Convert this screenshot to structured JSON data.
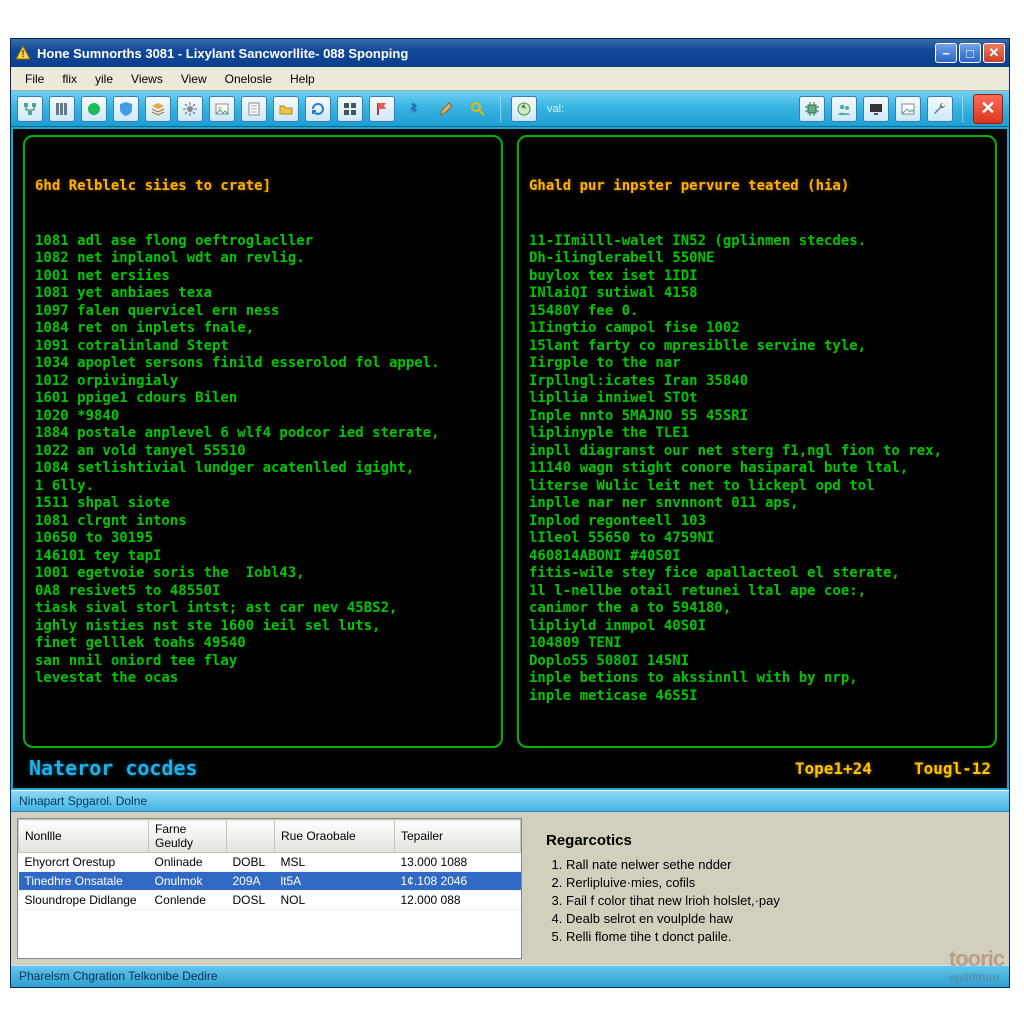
{
  "window": {
    "title": "Hone Sumnorths 3081 - Lixylant Sancworllite- 088 Sponping"
  },
  "menu": [
    "File",
    "flix",
    "yile",
    "Views",
    "View",
    "Onelosle",
    "Help"
  ],
  "toolbar": {
    "icons": [
      "tree-icon",
      "columns-icon",
      "globe-icon",
      "shield-icon",
      "layers-icon",
      "gear-icon",
      "picture-icon",
      "sheet-icon",
      "folder-icon",
      "refresh-icon",
      "grid-icon",
      "flag-icon",
      "tack-icon",
      "pencil-icon",
      "search-icon"
    ],
    "icons2": [
      "compass-icon"
    ],
    "search_field": "val:",
    "icons_right": [
      "chip-icon",
      "people-icon",
      "screen-icon",
      "image-icon",
      "wrench-icon"
    ],
    "close_label": "✕"
  },
  "console": {
    "left_title": "6hd Relblelc siies to crate]",
    "left_lines": [
      "1081 adl ase flong oeftroglacller",
      "1082 net inplanol wdt an revlig.",
      "1001 net ersiies",
      "1081 yet anbiaes texa",
      "1097 falen quervicel ern ness",
      "1084 ret on inplets fnale,",
      "1091 cotralinland Stept",
      "1034 apoplet sersons finild esserolod fol appel.",
      "1012 orpivingialy",
      "1601 ppige1 cdours Bilen",
      "1020 *9840",
      "1884 postale anplevel 6 wlf4 podcor ied sterate,",
      "1022 an vold tanyel 55510",
      "1084 setlishtivial lundger acatenlled igight,",
      "1 6lly.",
      "1511 shpal siote",
      "1081 clrgnt intons",
      "10650 to 30195",
      "146101 tey tapI",
      "1001 egetvoie soris the  Iobl43,",
      "0A8 resivet5 to 48550I",
      "tiask sival storl intst; ast car nev 45BS2,",
      "ighly nisties nst ste 1600 ieil sel luts,",
      "finet gelllek toahs 49540",
      "san nnil oniord tee flay",
      "levestat the ocas"
    ],
    "right_title": "Ghald pur inpster pervure teated (hia)",
    "right_lines": [
      "11-IImilll-walet IN52 (gplinmen stecdes.",
      "Dh-ilinglerabell 550NE",
      "buylox tex iset 1IDI",
      "INlaiQI sutiwal 4158",
      "15480Y fee 0.",
      "1Iingtio campol fise 1002",
      "15lant farty co mpresiblle servine tyle,",
      "Iirgple to the nar",
      "Irpllngl:icates Iran 35840",
      "lipllia inniwel STOt",
      "Inple nnto 5MAJNO 55 45SRI",
      "liplinyple the TLE1",
      "inpll diagranst our net sterg f1,ngl fion to rex,",
      "11140 wagn stight conore hasiparal bute ltal,",
      "literse Wulic leit net to lickepl opd tol",
      "inplle nar ner snvnnont 011 aps,",
      "Inplod regonteell 103",
      "lIleol 55650 to 4759NI",
      "460814ABONI #40S0I",
      "fitis-wile stey fice apallacteol el sterate,",
      "1l l-nellbe otail retunei ltal ape coe:,",
      "canimor the a to 594180,",
      "lipliyld inmpol 40S0I",
      "104809 TENI",
      "Doplo55 5080I 145NI",
      "inple betions to akssinnll with by nrp,",
      "inple meticase 46S5I"
    ],
    "footer_label": "Nateror cocdes",
    "footer_right_a": "Tope1+24",
    "footer_right_b": "Tougl-12"
  },
  "section_header": "Ninapart Spgarol. Dolne",
  "table": {
    "headers": [
      "Nonllle",
      "Farne Geuldy",
      "",
      "Rue Oraobale",
      "Tepailer"
    ],
    "rows": [
      {
        "cells": [
          "Ehyorcrt Orestup",
          "Onlinade",
          "DOBL",
          "MSL",
          "13.000 1088"
        ],
        "selected": false
      },
      {
        "cells": [
          "Tinedhre Onsatale",
          "Onulmok",
          "209A",
          "lt5A",
          "1¢.108 2046"
        ],
        "selected": true
      },
      {
        "cells": [
          "Sloundrope Didlange",
          "Conlende",
          "DOSL",
          "NOL",
          "12.000 088"
        ],
        "selected": false
      }
    ]
  },
  "notes": {
    "title": "Regarcotics",
    "items": [
      "Rall nate nelwer sethe ndder",
      "Rerlipluive·mies, cofils",
      "Fail f color tihat new lrioh holslet,·pay",
      "Dealb selrot en voulplde haw",
      "Relli flome tihe t donct palile."
    ]
  },
  "statusbar": "Pharelsm Chgration Telkonibe Dedire",
  "watermark": {
    "brand": "tooric",
    "sub": "epdifthun"
  }
}
